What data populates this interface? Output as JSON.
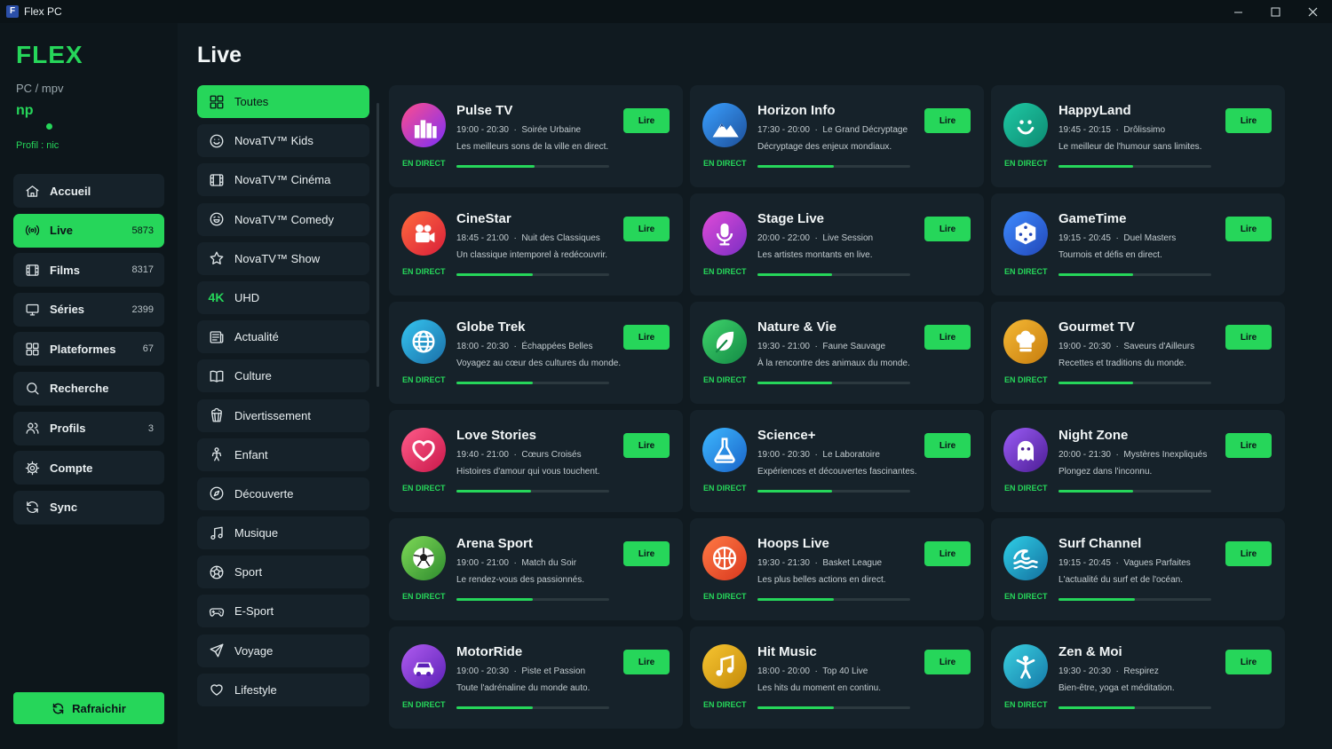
{
  "window": {
    "title": "Flex PC",
    "app_icon": "flex-app-icon"
  },
  "sidebar": {
    "logo": "FLEX",
    "subtitle": "PC / mpv",
    "avatar_initials": "np",
    "profile_label": "Profil : nic",
    "nav": [
      {
        "label": "Accueil",
        "count": "",
        "icon": "home-icon"
      },
      {
        "label": "Live",
        "count": "5873",
        "icon": "broadcast-icon",
        "active": true
      },
      {
        "label": "Films",
        "count": "8317",
        "icon": "film-icon"
      },
      {
        "label": "Séries",
        "count": "2399",
        "icon": "tv-icon"
      },
      {
        "label": "Plateformes",
        "count": "67",
        "icon": "grid-icon"
      },
      {
        "label": "Recherche",
        "count": "",
        "icon": "search-icon"
      },
      {
        "label": "Profils",
        "count": "3",
        "icon": "users-icon"
      },
      {
        "label": "Compte",
        "count": "",
        "icon": "gear-icon"
      },
      {
        "label": "Sync",
        "count": "",
        "icon": "sync-icon"
      }
    ],
    "refresh_label": "Rafraichir"
  },
  "main": {
    "title": "Live",
    "categories": [
      {
        "label": "Toutes",
        "icon": "grid-icon",
        "active": true
      },
      {
        "label": "NovaTV™ Kids",
        "icon": "smile-icon"
      },
      {
        "label": "NovaTV™ Cinéma",
        "icon": "film-icon"
      },
      {
        "label": "NovaTV™ Comedy",
        "icon": "laugh-icon"
      },
      {
        "label": "NovaTV™ Show",
        "icon": "star-icon"
      },
      {
        "label": "UHD",
        "icon": "4k-icon",
        "icon_text": "4K"
      },
      {
        "label": "Actualité",
        "icon": "newspaper-icon"
      },
      {
        "label": "Culture",
        "icon": "book-icon"
      },
      {
        "label": "Divertissement",
        "icon": "popcorn-icon"
      },
      {
        "label": "Enfant",
        "icon": "child-icon"
      },
      {
        "label": "Découverte",
        "icon": "compass-icon"
      },
      {
        "label": "Musique",
        "icon": "music-icon"
      },
      {
        "label": "Sport",
        "icon": "ball-icon"
      },
      {
        "label": "E-Sport",
        "icon": "gamepad-icon"
      },
      {
        "label": "Voyage",
        "icon": "plane-icon"
      },
      {
        "label": "Lifestyle",
        "icon": "heart-icon"
      }
    ],
    "live_badge": "EN DIRECT",
    "play_label": "Lire",
    "channels": [
      {
        "name": "Pulse TV",
        "time": "19:00 - 20:30",
        "show": "Soirée Urbaine",
        "desc": "Les meilleurs sons de la ville en direct.",
        "progress": 0.51,
        "icon": "city-icon",
        "colors": [
          "#ff4d8d",
          "#7b2ff7"
        ]
      },
      {
        "name": "Horizon Info",
        "time": "17:30 - 20:00",
        "show": "Le Grand Décryptage",
        "desc": "Décryptage des enjeux mondiaux.",
        "progress": 0.5,
        "icon": "mountain-icon",
        "colors": [
          "#3aa0ff",
          "#1d4f9a"
        ]
      },
      {
        "name": "HappyLand",
        "time": "19:45 - 20:15",
        "show": "Drôlissimo",
        "desc": "Le meilleur de l'humour sans limites.",
        "progress": 0.49,
        "icon": "smiley-icon",
        "colors": [
          "#1fc9a4",
          "#0d8a72"
        ]
      },
      {
        "name": "CineStar",
        "time": "18:45 - 21:00",
        "show": "Nuit des Classiques",
        "desc": "Un classique intemporel à redécouvrir.",
        "progress": 0.5,
        "icon": "camera-icon",
        "colors": [
          "#ff6a3d",
          "#d91f3a"
        ]
      },
      {
        "name": "Stage Live",
        "time": "20:00 - 22:00",
        "show": "Live Session",
        "desc": "Les artistes montants en live.",
        "progress": 0.49,
        "icon": "microphone-icon",
        "colors": [
          "#e14bd8",
          "#7a2ec4"
        ]
      },
      {
        "name": "GameTime",
        "time": "19:15 - 20:45",
        "show": "Duel Masters",
        "desc": "Tournois et défis en direct.",
        "progress": 0.49,
        "icon": "dice-icon",
        "colors": [
          "#3d8bff",
          "#2247b8"
        ]
      },
      {
        "name": "Globe Trek",
        "time": "18:00 - 20:30",
        "show": "Échappées Belles",
        "desc": "Voyagez au cœur des cultures du monde.",
        "progress": 0.5,
        "icon": "globe-icon",
        "colors": [
          "#35c5f0",
          "#1b6fa8"
        ]
      },
      {
        "name": "Nature & Vie",
        "time": "19:30 - 21:00",
        "show": "Faune Sauvage",
        "desc": "À la rencontre des animaux du monde.",
        "progress": 0.49,
        "icon": "leaf-icon",
        "colors": [
          "#3fd46b",
          "#138a45"
        ]
      },
      {
        "name": "Gourmet TV",
        "time": "19:00 - 20:30",
        "show": "Saveurs d'Ailleurs",
        "desc": "Recettes et traditions du monde.",
        "progress": 0.49,
        "icon": "chef-hat-icon",
        "colors": [
          "#f5b935",
          "#c77d0e"
        ]
      },
      {
        "name": "Love Stories",
        "time": "19:40 - 21:00",
        "show": "Cœurs Croisés",
        "desc": "Histoires d'amour qui vous touchent.",
        "progress": 0.49,
        "icon": "heart-icon",
        "colors": [
          "#ff5c8a",
          "#c9184a"
        ]
      },
      {
        "name": "Science+",
        "time": "19:00 - 20:30",
        "show": "Le Laboratoire",
        "desc": "Expériences et découvertes fascinantes.",
        "progress": 0.49,
        "icon": "flask-icon",
        "colors": [
          "#3db8ff",
          "#1a64c9"
        ]
      },
      {
        "name": "Night Zone",
        "time": "20:00 - 21:30",
        "show": "Mystères Inexpliqués",
        "desc": "Plongez dans l'inconnu.",
        "progress": 0.49,
        "icon": "ghost-icon",
        "colors": [
          "#9b5cf6",
          "#4c1d95"
        ]
      },
      {
        "name": "Arena Sport",
        "time": "19:00 - 21:00",
        "show": "Match du Soir",
        "desc": "Le rendez-vous des passionnés.",
        "progress": 0.5,
        "icon": "soccer-ball-icon",
        "colors": [
          "#7ed957",
          "#2e8b2e"
        ]
      },
      {
        "name": "Hoops Live",
        "time": "19:30 - 21:30",
        "show": "Basket League",
        "desc": "Les plus belles actions en direct.",
        "progress": 0.5,
        "icon": "basketball-icon",
        "colors": [
          "#ff7a45",
          "#d9381e"
        ]
      },
      {
        "name": "Surf Channel",
        "time": "19:15 - 20:45",
        "show": "Vagues Parfaites",
        "desc": "L'actualité du surf et de l'océan.",
        "progress": 0.5,
        "icon": "wave-icon",
        "colors": [
          "#2fd0e8",
          "#136f9e"
        ]
      },
      {
        "name": "MotorRide",
        "time": "19:00 - 20:30",
        "show": "Piste et Passion",
        "desc": "Toute l'adrénaline du monde auto.",
        "progress": 0.5,
        "icon": "car-icon",
        "colors": [
          "#b05cf0",
          "#5b21b6"
        ]
      },
      {
        "name": "Hit Music",
        "time": "18:00 - 20:00",
        "show": "Top 40 Live",
        "desc": "Les hits du moment en continu.",
        "progress": 0.5,
        "icon": "music-note-icon",
        "colors": [
          "#f7c531",
          "#c48a0a"
        ]
      },
      {
        "name": "Zen & Moi",
        "time": "19:30 - 20:30",
        "show": "Respirez",
        "desc": "Bien-être, yoga et méditation.",
        "progress": 0.5,
        "icon": "yoga-icon",
        "colors": [
          "#3ad1e0",
          "#1579a8"
        ]
      }
    ]
  }
}
